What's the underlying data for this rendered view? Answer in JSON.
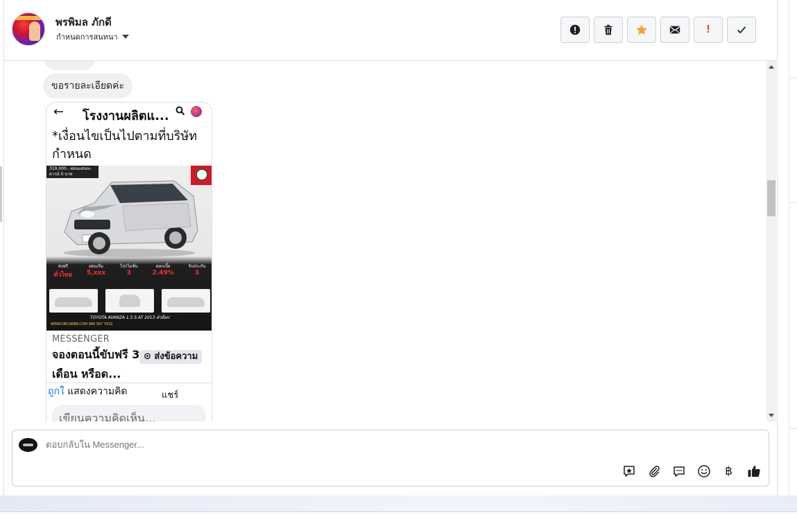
{
  "header": {
    "contact_name": "พรพิมล ภักดี",
    "conversation_setting": "กำหนดการสนทนา"
  },
  "actions": [
    {
      "name": "spam-button",
      "icon": "exclamation-circle-icon"
    },
    {
      "name": "delete-button",
      "icon": "trash-icon"
    },
    {
      "name": "star-button",
      "icon": "star-icon",
      "color": "#f5a623"
    },
    {
      "name": "mark-unread-button",
      "icon": "envelope-icon"
    },
    {
      "name": "follow-up-button",
      "icon": "red-exclamation-icon",
      "glyph": "!",
      "color": "#e4402f"
    },
    {
      "name": "mark-done-button",
      "icon": "check-icon"
    }
  ],
  "messages": {
    "bubble_1": "ขอรายละเอียดค่ะ"
  },
  "shared_screenshot": {
    "back_glyph": "←",
    "page_title": "โรงงานผลิตแ...",
    "body_text": "*เงื่อนไขเป็นไปตามที่บริษัทกำหนด",
    "ad": {
      "price_text": "319,000.- ผ่อนแสนละ ดาวน์ 0 บาท",
      "promos": [
        {
          "label": "ส่งฟรี",
          "value": "ทั่วไทย"
        },
        {
          "label": "ผ่อนเริ่ม",
          "value": "5,xxx"
        },
        {
          "label": "โปรโมชั่น",
          "value": "3"
        },
        {
          "label": "ดอกเบี้ย",
          "value": "2.49%"
        },
        {
          "label": "รับประกัน",
          "value": "3"
        }
      ],
      "model": "TOYOTA AVANZA 1.5 S AT 2013 ตัวท็อป",
      "footer": "WWW.OECAR88.COM  086 587 7022"
    },
    "source": "MESSENGER",
    "headline": "จองตอนนี้ขับฟรี 3 เดือน หรือด...",
    "send_button": "⊙ ส่งข้อความ",
    "reactions": "ถูกใ",
    "comment_action": "แสดงความคิด",
    "share_action": "แชร์",
    "comment_placeholder": "เขียนความคิดเห็น..."
  },
  "composer": {
    "placeholder": "ตอบกลับใน Messenger...",
    "tools": [
      "saved-reply-icon",
      "attachment-icon",
      "chat-bubble-icon",
      "emoji-icon",
      "baht-icon",
      "thumbs-up-icon"
    ],
    "baht_glyph": "฿"
  }
}
